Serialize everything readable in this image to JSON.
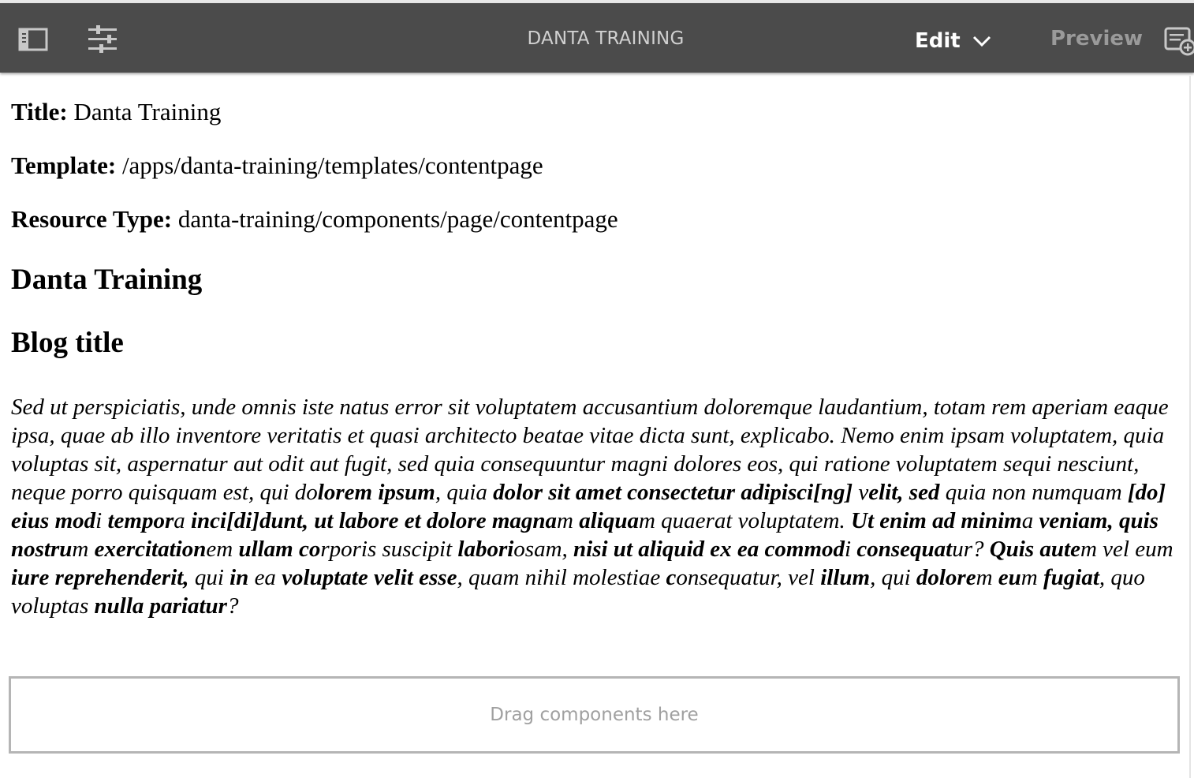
{
  "toolbar": {
    "page_title": "DANTA TRAINING",
    "mode_label": "Edit",
    "preview_label": "Preview",
    "icons": {
      "side_panel": "side-panel-icon",
      "page_properties": "page-properties-icon",
      "mode_dropdown": "chevron-down-icon",
      "annotations": "annotations-icon"
    },
    "colors": {
      "bar": "#4b4b4b",
      "title": "#d0d0d0",
      "active": "#ffffff",
      "inactive": "#9a9a9a"
    }
  },
  "properties": {
    "title_label": "Title:",
    "title_value": "Danta Training",
    "template_label": "Template:",
    "template_value": "/apps/danta-training/templates/contentpage",
    "resource_type_label": "Resource Type:",
    "resource_type_value": "danta-training/components/page/contentpage"
  },
  "headings": {
    "page_heading": "Danta Training",
    "blog_title": "Blog title"
  },
  "body": {
    "segments": [
      {
        "t": "Sed ut perspiciatis, unde omnis iste natus error sit voluptatem accusantium doloremque laudantium, totam rem aperiam eaque ipsa, quae ab illo inventore veritatis et quasi architecto beatae vitae dicta sunt, explicabo. Nemo enim ipsam voluptatem, quia voluptas sit, aspernatur aut odit aut fugit, sed quia consequuntur magni dolores eos, qui ratione voluptatem sequi nesciunt, neque porro quisquam est, qui do",
        "b": false
      },
      {
        "t": "lorem ipsum",
        "b": true
      },
      {
        "t": ", quia ",
        "b": false
      },
      {
        "t": "dolor sit amet consectetur adipisci[ng]",
        "b": true
      },
      {
        "t": " v",
        "b": false
      },
      {
        "t": "elit, sed",
        "b": true
      },
      {
        "t": " quia non numquam ",
        "b": false
      },
      {
        "t": "[do] eius mod",
        "b": true
      },
      {
        "t": "i ",
        "b": false
      },
      {
        "t": "tempor",
        "b": true
      },
      {
        "t": "a ",
        "b": false
      },
      {
        "t": "inci[di]dunt, ut labore et dolore magna",
        "b": true
      },
      {
        "t": "m ",
        "b": false
      },
      {
        "t": "aliqua",
        "b": true
      },
      {
        "t": "m quaerat voluptatem. ",
        "b": false
      },
      {
        "t": "Ut enim ad minim",
        "b": true
      },
      {
        "t": "a ",
        "b": false
      },
      {
        "t": "veniam, quis nostru",
        "b": true
      },
      {
        "t": "m ",
        "b": false
      },
      {
        "t": "exercitation",
        "b": true
      },
      {
        "t": "em ",
        "b": false
      },
      {
        "t": "ullam co",
        "b": true
      },
      {
        "t": "rporis suscipit ",
        "b": false
      },
      {
        "t": "labori",
        "b": true
      },
      {
        "t": "osam, ",
        "b": false
      },
      {
        "t": "nisi ut aliquid ex ea commod",
        "b": true
      },
      {
        "t": "i ",
        "b": false
      },
      {
        "t": "consequat",
        "b": true
      },
      {
        "t": "ur? ",
        "b": false
      },
      {
        "t": "Quis aute",
        "b": true
      },
      {
        "t": "m vel eum ",
        "b": false
      },
      {
        "t": "iure reprehenderit,",
        "b": true
      },
      {
        "t": " qui ",
        "b": false
      },
      {
        "t": "in",
        "b": true
      },
      {
        "t": " ea ",
        "b": false
      },
      {
        "t": "voluptate velit esse",
        "b": true
      },
      {
        "t": ", quam nihil molestiae ",
        "b": false
      },
      {
        "t": "c",
        "b": true
      },
      {
        "t": "onsequatur, vel ",
        "b": false
      },
      {
        "t": "illum",
        "b": true
      },
      {
        "t": ", qui ",
        "b": false
      },
      {
        "t": "dolore",
        "b": true
      },
      {
        "t": "m ",
        "b": false
      },
      {
        "t": "eu",
        "b": true
      },
      {
        "t": "m ",
        "b": false
      },
      {
        "t": "fugiat",
        "b": true
      },
      {
        "t": ", quo voluptas ",
        "b": false
      },
      {
        "t": "nulla pariatur",
        "b": true
      },
      {
        "t": "?",
        "b": false
      }
    ]
  },
  "dropzone": {
    "placeholder": "Drag components here"
  }
}
